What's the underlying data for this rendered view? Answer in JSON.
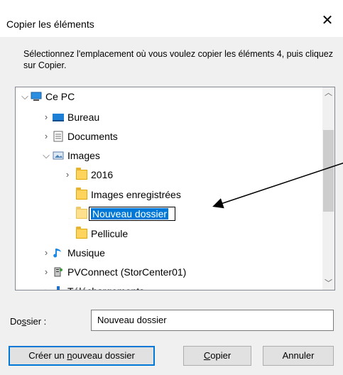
{
  "window": {
    "title": "Copier les éléments"
  },
  "instruction": "Sélectionnez l'emplacement où vous voulez copier les éléments 4, puis cliquez sur Copier.",
  "tree": {
    "root": "Ce PC",
    "bureau": "Bureau",
    "documents": "Documents",
    "images": "Images",
    "y2016": "2016",
    "images_enregistrees": "Images enregistrées",
    "nouveau_dossier": "Nouveau dossier",
    "pellicule": "Pellicule",
    "musique": "Musique",
    "pvconnect": "PVConnect (StorCenter01)",
    "telechargements": "Téléchargements"
  },
  "dossier": {
    "label_pre": "Do",
    "label_ul": "s",
    "label_post": "sier :",
    "value": "Nouveau dossier"
  },
  "buttons": {
    "create_pre": "Créer un ",
    "create_ul": "n",
    "create_post": "ouveau dossier",
    "copy_ul": "C",
    "copy_post": "opier",
    "cancel": "Annuler"
  },
  "colors": {
    "accent": "#0078d7",
    "folder": "#ffd45c"
  }
}
